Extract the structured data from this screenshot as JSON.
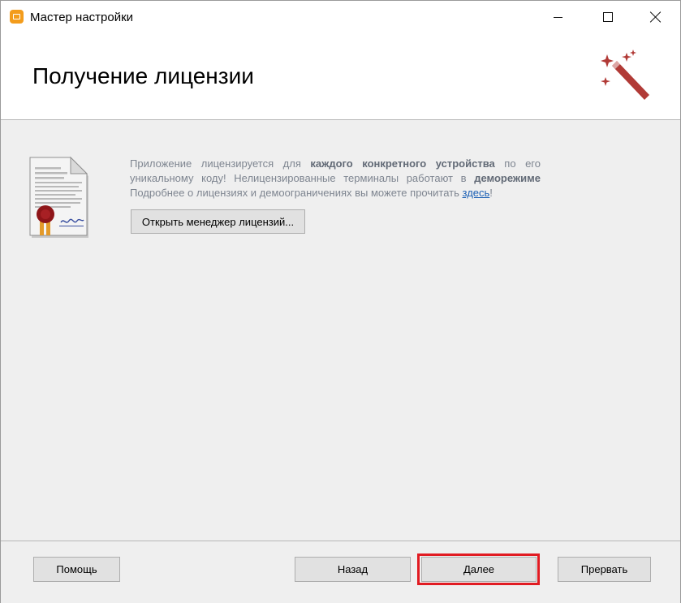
{
  "window": {
    "title": "Мастер настройки",
    "icon": "app-icon",
    "accent_color": "#f39c1c"
  },
  "header": {
    "title": "Получение лицензии",
    "icon": "magic-wand-icon",
    "icon_color": "#b13a36"
  },
  "content": {
    "icon": "license-certificate-icon",
    "line1_a": "Приложение лицензируется для",
    "line1_b": "каждого конкретного устройства",
    "line1_c": "по его",
    "line2_a": "уникальному коду! Нелицензированные терминалы работают в",
    "line2_b": "деморежиме",
    "line3_a": "Подробнее о лицензиях и демоограничениях вы можете прочитать",
    "line3_link": "здесь",
    "line3_c": "!",
    "license_manager_button": "Открыть менеджер лицензий..."
  },
  "footer": {
    "help": "Помощь",
    "back": "Назад",
    "next": "Далее",
    "cancel": "Прервать",
    "highlight_color": "#e11b22"
  }
}
